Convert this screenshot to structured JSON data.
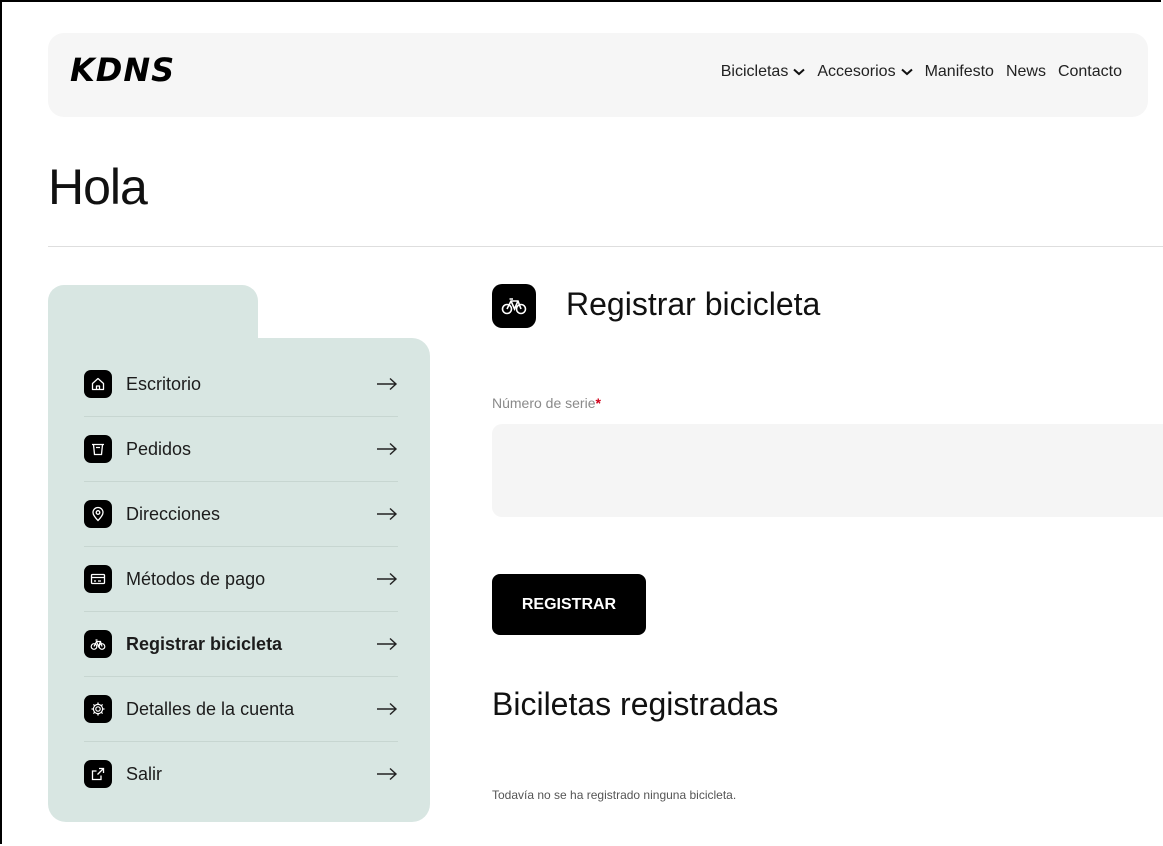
{
  "header": {
    "logo": "KDNS",
    "nav": [
      {
        "label": "Bicicletas",
        "dropdown": true
      },
      {
        "label": "Accesorios",
        "dropdown": true
      },
      {
        "label": "Manifesto",
        "dropdown": false
      },
      {
        "label": "News",
        "dropdown": false
      },
      {
        "label": "Contacto",
        "dropdown": false
      }
    ]
  },
  "page": {
    "title": "Hola"
  },
  "sidebar": {
    "items": [
      {
        "label": "Escritorio",
        "icon": "home-icon",
        "active": false
      },
      {
        "label": "Pedidos",
        "icon": "basket-icon",
        "active": false
      },
      {
        "label": "Direcciones",
        "icon": "location-pin-icon",
        "active": false
      },
      {
        "label": "Métodos de pago",
        "icon": "credit-card-icon",
        "active": false
      },
      {
        "label": "Registrar bicicleta",
        "icon": "bicycle-icon",
        "active": true
      },
      {
        "label": "Detalles de la cuenta",
        "icon": "gear-icon",
        "active": false
      },
      {
        "label": "Salir",
        "icon": "external-link-icon",
        "active": false
      }
    ]
  },
  "main": {
    "section_title": "Registrar bicicleta",
    "serial_label": "Número de serie",
    "required_mark": "*",
    "serial_value": "",
    "register_button": "REGISTRAR",
    "registered_title": "Biciletas registradas",
    "empty_message": "Todavía no se ha registrado ninguna bicicleta."
  },
  "colors": {
    "sidebar_bg": "#d8e6e2",
    "header_bg": "#f6f6f6",
    "button_bg": "#000000",
    "required": "#d0021b"
  }
}
